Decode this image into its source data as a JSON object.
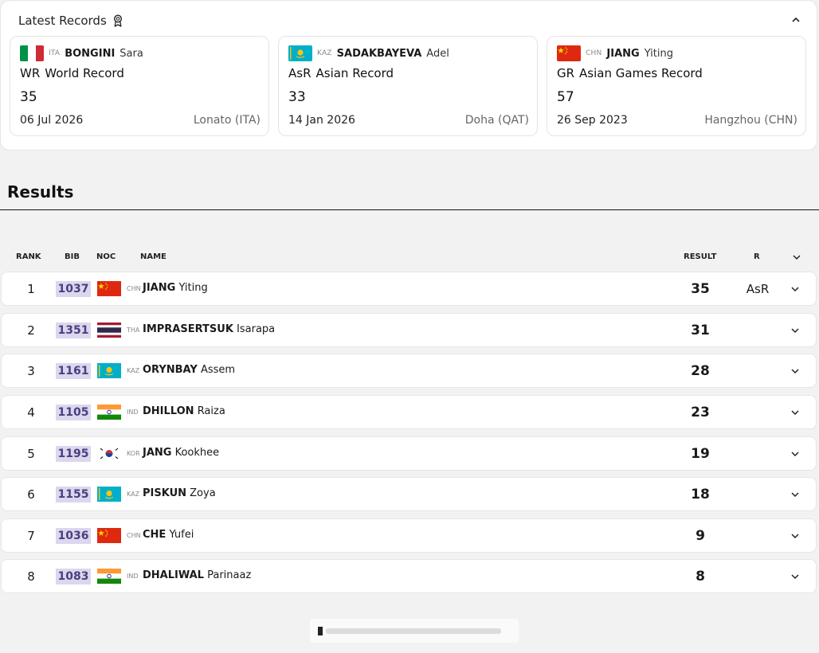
{
  "latest_records": {
    "title": "Latest Records",
    "cards": [
      {
        "noc": "ITA",
        "family": "BONGINI",
        "given": "Sara",
        "abbr": "WR",
        "type": "World Record",
        "value": "35",
        "date": "06 Jul 2026",
        "place": "Lonato (ITA)"
      },
      {
        "noc": "KAZ",
        "family": "SADAKBAYEVA",
        "given": "Adel",
        "abbr": "AsR",
        "type": "Asian Record",
        "value": "33",
        "date": "14 Jan 2026",
        "place": "Doha (QAT)"
      },
      {
        "noc": "CHN",
        "family": "JIANG",
        "given": "Yiting",
        "abbr": "GR",
        "type": "Asian Games Record",
        "value": "57",
        "date": "26 Sep 2023",
        "place": "Hangzhou (CHN)"
      }
    ]
  },
  "results": {
    "title": "Results",
    "headers": {
      "rank": "RANK",
      "bib": "BIB",
      "noc": "NOC",
      "name": "NAME",
      "result": "RESULT",
      "record": "R"
    },
    "rows": [
      {
        "rank": "1",
        "bib": "1037",
        "noc": "CHN",
        "family": "JIANG",
        "given": "Yiting",
        "result": "35",
        "record": "AsR"
      },
      {
        "rank": "2",
        "bib": "1351",
        "noc": "THA",
        "family": "IMPRASERTSUK",
        "given": "Isarapa",
        "result": "31",
        "record": ""
      },
      {
        "rank": "3",
        "bib": "1161",
        "noc": "KAZ",
        "family": "ORYNBAY",
        "given": "Assem",
        "result": "28",
        "record": ""
      },
      {
        "rank": "4",
        "bib": "1105",
        "noc": "IND",
        "family": "DHILLON",
        "given": "Raiza",
        "result": "23",
        "record": ""
      },
      {
        "rank": "5",
        "bib": "1195",
        "noc": "KOR",
        "family": "JANG",
        "given": "Kookhee",
        "result": "19",
        "record": ""
      },
      {
        "rank": "6",
        "bib": "1155",
        "noc": "KAZ",
        "family": "PISKUN",
        "given": "Zoya",
        "result": "18",
        "record": ""
      },
      {
        "rank": "7",
        "bib": "1036",
        "noc": "CHN",
        "family": "CHE",
        "given": "Yufei",
        "result": "9",
        "record": ""
      },
      {
        "rank": "8",
        "bib": "1083",
        "noc": "IND",
        "family": "DHALIWAL",
        "given": "Parinaaz",
        "result": "8",
        "record": ""
      }
    ]
  },
  "icons": {
    "records": "ribbon-medal-icon",
    "collapse": "chevron-up-icon",
    "expand": "chevron-down-icon"
  },
  "colors": {
    "bib_bg": "#dcd6ee",
    "bib_text": "#4a4080",
    "panel_bg": "#ffffff",
    "page_bg": "#f2f2f2"
  }
}
